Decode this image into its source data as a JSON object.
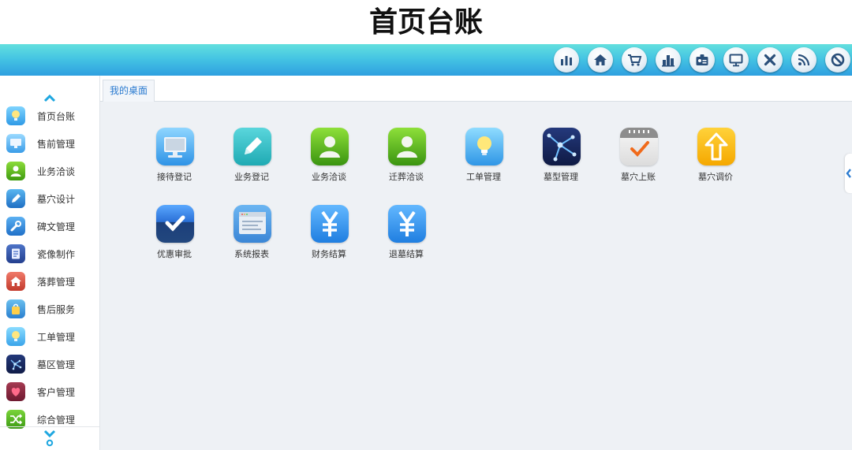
{
  "page_title": "首页台账",
  "colors": {
    "accent": "#2e9fe0",
    "topbar_start": "#63e0de",
    "desktop_bg": "#eef1f5",
    "tab_text": "#2b7bd0"
  },
  "toolbar": {
    "buttons": [
      {
        "icon": "bar-chart-icon"
      },
      {
        "icon": "home-icon"
      },
      {
        "icon": "cart-icon"
      },
      {
        "icon": "building-icon"
      },
      {
        "icon": "id-card-icon"
      },
      {
        "icon": "monitor-icon"
      },
      {
        "icon": "close-icon"
      },
      {
        "icon": "rss-icon"
      },
      {
        "icon": "block-icon"
      }
    ]
  },
  "sidebar": {
    "items": [
      {
        "label": "首页台账",
        "icon": "lightbulb-icon"
      },
      {
        "label": "售前管理",
        "icon": "monitor-icon"
      },
      {
        "label": "业务洽谈",
        "icon": "user-icon"
      },
      {
        "label": "墓穴设计",
        "icon": "pencil-icon"
      },
      {
        "label": "碑文管理",
        "icon": "wrench-icon"
      },
      {
        "label": "瓷像制作",
        "icon": "document-icon"
      },
      {
        "label": "落葬管理",
        "icon": "house-icon"
      },
      {
        "label": "售后服务",
        "icon": "bag-icon"
      },
      {
        "label": "工单管理",
        "icon": "lightbulb-icon"
      },
      {
        "label": "墓区管理",
        "icon": "network-icon"
      },
      {
        "label": "客户管理",
        "icon": "heart-icon"
      },
      {
        "label": "综合管理",
        "icon": "shuffle-icon"
      }
    ]
  },
  "tabs": [
    {
      "label": "我的桌面"
    }
  ],
  "desktop": {
    "apps": [
      {
        "label": "接待登记",
        "icon": "monitor-icon"
      },
      {
        "label": "业务登记",
        "icon": "pencil-icon"
      },
      {
        "label": "业务洽谈",
        "icon": "user-icon"
      },
      {
        "label": "迁葬洽谈",
        "icon": "user-icon"
      },
      {
        "label": "工单管理",
        "icon": "lightbulb-icon"
      },
      {
        "label": "墓型管理",
        "icon": "network-icon"
      },
      {
        "label": "墓穴上账",
        "icon": "calendar-check-icon"
      },
      {
        "label": "墓穴调价",
        "icon": "arrow-up-icon"
      },
      {
        "label": "优惠审批",
        "icon": "check-icon"
      },
      {
        "label": "系统报表",
        "icon": "report-icon"
      },
      {
        "label": "财务结算",
        "icon": "yen-icon"
      },
      {
        "label": "退墓结算",
        "icon": "yen-icon"
      }
    ]
  }
}
